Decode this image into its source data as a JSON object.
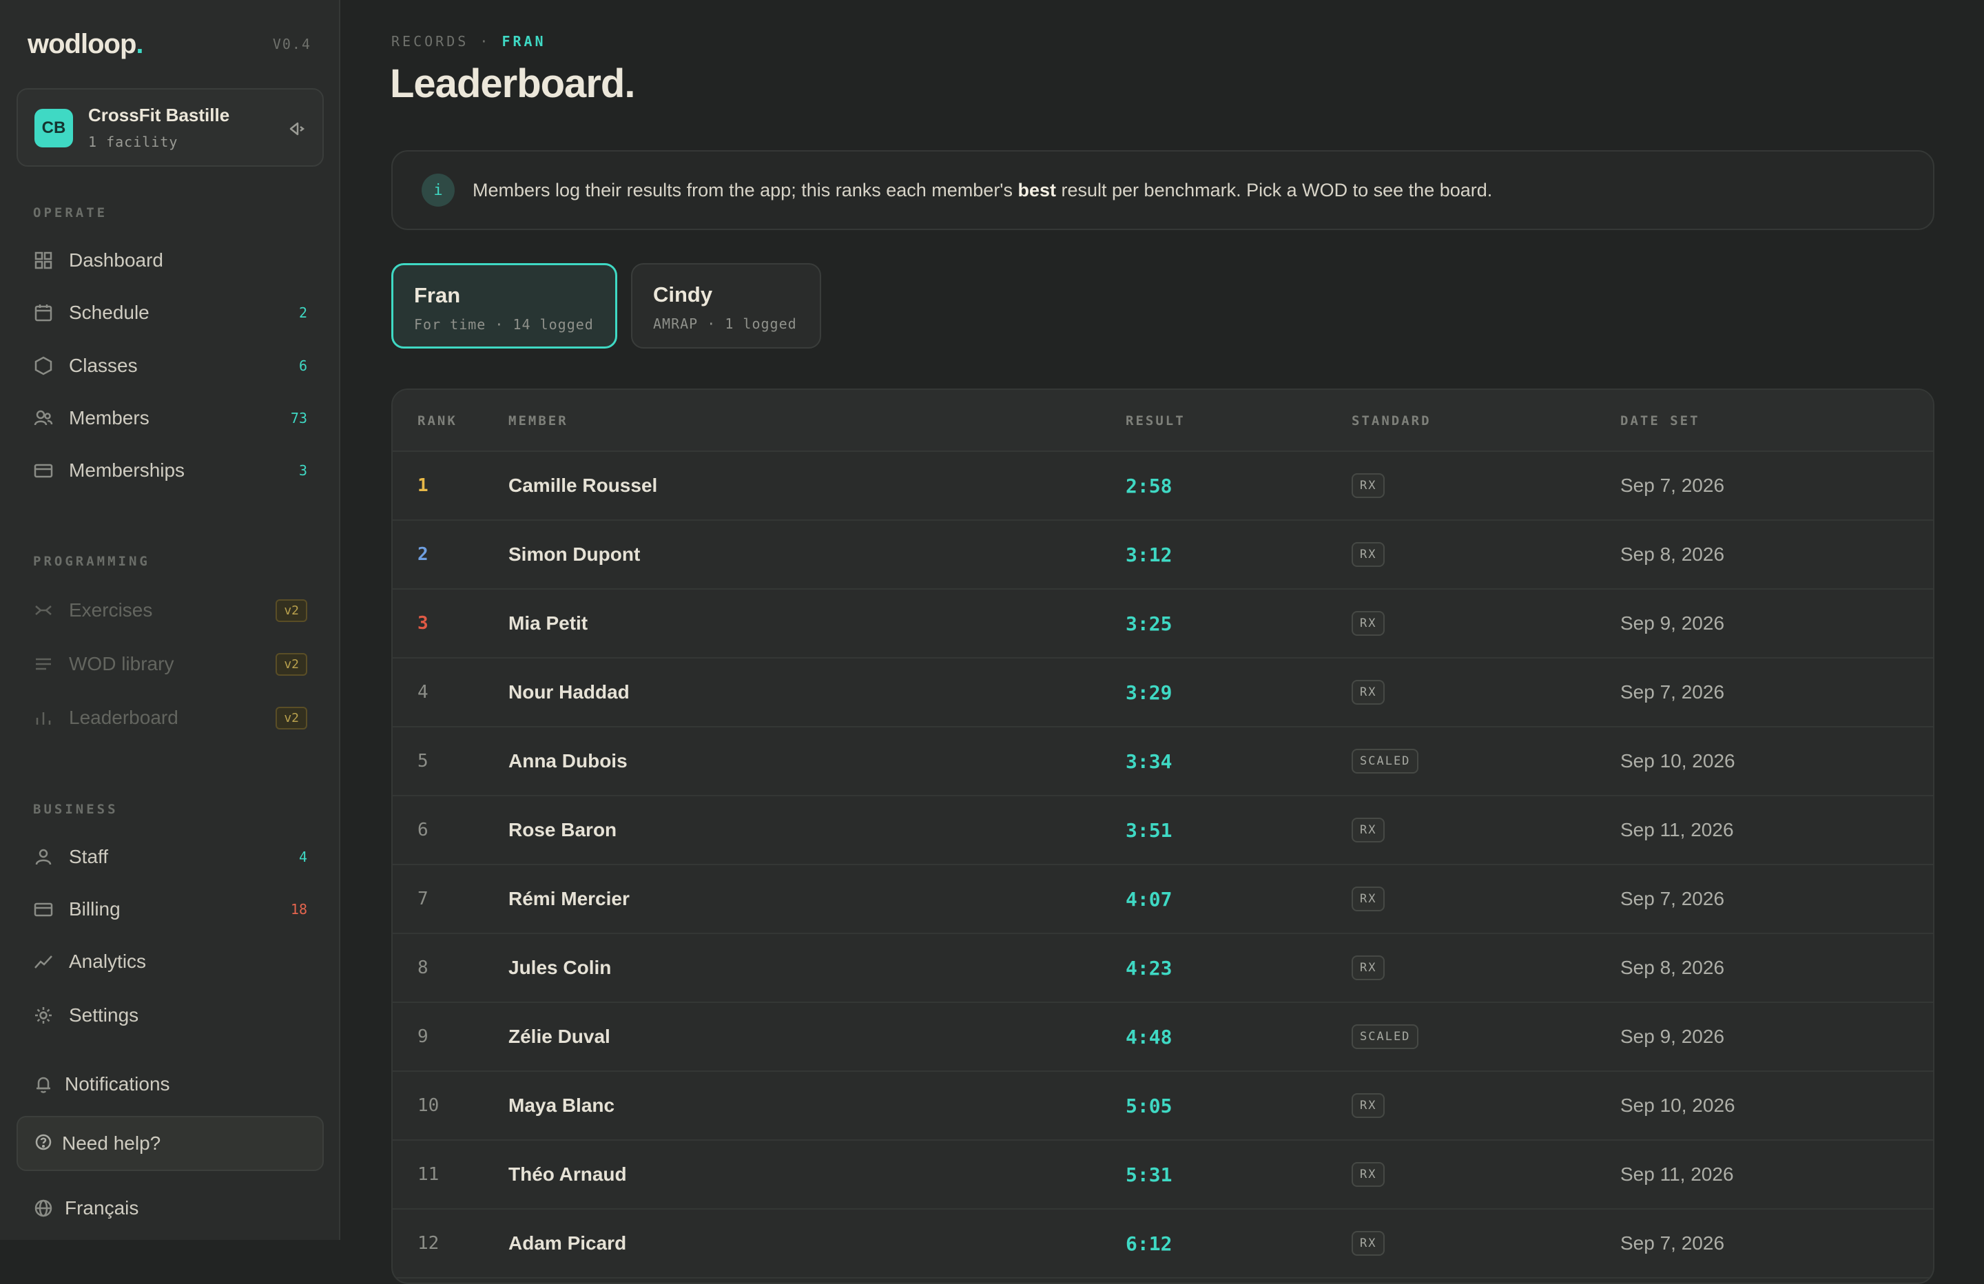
{
  "brand": {
    "name": "wodloop",
    "dot": ".",
    "version": "V0.4"
  },
  "org": {
    "initials": "CB",
    "name": "CrossFit Bastille",
    "facilities": "1 facility"
  },
  "sidebar": {
    "operate_label": "OPERATE",
    "operate": [
      {
        "label": "Dashboard",
        "count": ""
      },
      {
        "label": "Schedule",
        "count": "2"
      },
      {
        "label": "Classes",
        "count": "6"
      },
      {
        "label": "Members",
        "count": "73"
      },
      {
        "label": "Memberships",
        "count": "3"
      }
    ],
    "programming_label": "PROGRAMMING",
    "programming": [
      {
        "label": "Exercises",
        "badge": "v2"
      },
      {
        "label": "WOD library",
        "badge": "v2"
      },
      {
        "label": "Leaderboard",
        "badge": "v2"
      }
    ],
    "business_label": "BUSINESS",
    "business": [
      {
        "label": "Staff",
        "count": "4"
      },
      {
        "label": "Billing",
        "count": "18"
      },
      {
        "label": "Analytics",
        "count": ""
      },
      {
        "label": "Settings",
        "count": ""
      }
    ],
    "notifications": "Notifications",
    "help": "Need help?",
    "language": "Français"
  },
  "header": {
    "breadcrumb_root": "RECORDS",
    "breadcrumb_sep": "·",
    "breadcrumb_current": "FRAN",
    "title": "Leaderboard."
  },
  "info": {
    "icon": "i",
    "text_before": "Members log their results from the app; this ranks each member's ",
    "text_bold": "best",
    "text_after": " result per benchmark. Pick a WOD to see the board."
  },
  "wods": [
    {
      "name": "Fran",
      "meta": "For time · 14 logged"
    },
    {
      "name": "Cindy",
      "meta": "AMRAP · 1 logged"
    }
  ],
  "table": {
    "headers": {
      "rank": "RANK",
      "member": "MEMBER",
      "result": "RESULT",
      "standard": "STANDARD",
      "date": "DATE SET"
    },
    "rows": [
      {
        "rank": "1",
        "member": "Camille Roussel",
        "result": "2:58",
        "standard": "RX",
        "date": "Sep 7, 2026"
      },
      {
        "rank": "2",
        "member": "Simon Dupont",
        "result": "3:12",
        "standard": "RX",
        "date": "Sep 8, 2026"
      },
      {
        "rank": "3",
        "member": "Mia Petit",
        "result": "3:25",
        "standard": "RX",
        "date": "Sep 9, 2026"
      },
      {
        "rank": "4",
        "member": "Nour Haddad",
        "result": "3:29",
        "standard": "RX",
        "date": "Sep 7, 2026"
      },
      {
        "rank": "5",
        "member": "Anna Dubois",
        "result": "3:34",
        "standard": "SCALED",
        "date": "Sep 10, 2026"
      },
      {
        "rank": "6",
        "member": "Rose Baron",
        "result": "3:51",
        "standard": "RX",
        "date": "Sep 11, 2026"
      },
      {
        "rank": "7",
        "member": "Rémi Mercier",
        "result": "4:07",
        "standard": "RX",
        "date": "Sep 7, 2026"
      },
      {
        "rank": "8",
        "member": "Jules Colin",
        "result": "4:23",
        "standard": "RX",
        "date": "Sep 8, 2026"
      },
      {
        "rank": "9",
        "member": "Zélie Duval",
        "result": "4:48",
        "standard": "SCALED",
        "date": "Sep 9, 2026"
      },
      {
        "rank": "10",
        "member": "Maya Blanc",
        "result": "5:05",
        "standard": "RX",
        "date": "Sep 10, 2026"
      },
      {
        "rank": "11",
        "member": "Théo Arnaud",
        "result": "5:31",
        "standard": "RX",
        "date": "Sep 11, 2026"
      },
      {
        "rank": "12",
        "member": "Adam Picard",
        "result": "6:12",
        "standard": "RX",
        "date": "Sep 7, 2026"
      }
    ]
  },
  "colors": {
    "accent": "#3fd9c4",
    "gold": "#e8b948",
    "silver": "#6f9fe0",
    "bronze": "#e05a45",
    "alert": "#e4654e"
  }
}
